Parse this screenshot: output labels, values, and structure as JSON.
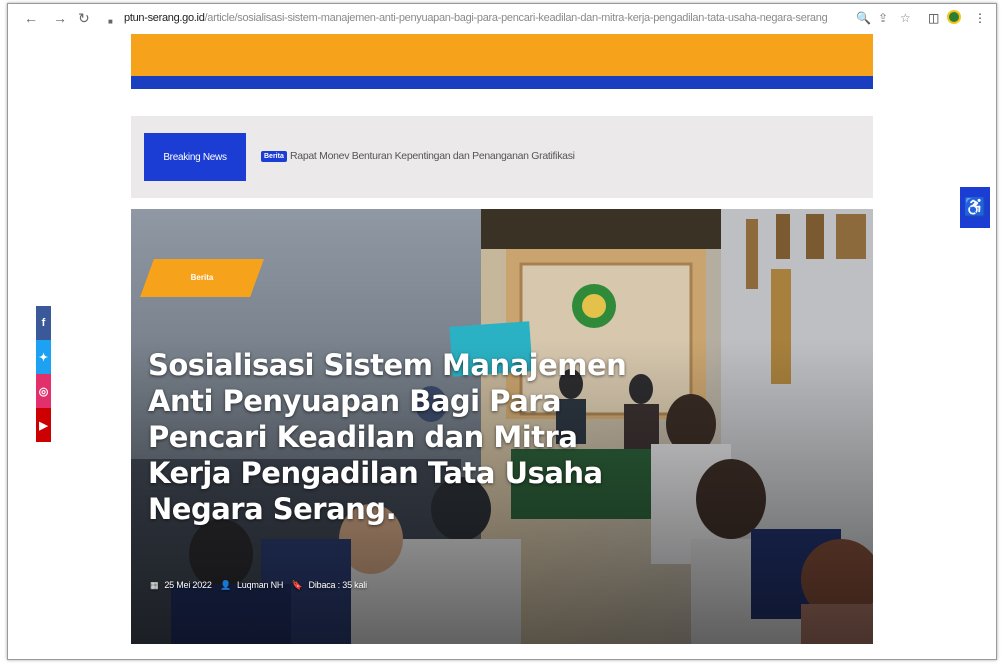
{
  "browser": {
    "back_glyph": "←",
    "forward_glyph": "→",
    "reload_glyph": "↻",
    "lock_glyph": "■",
    "url_host": "ptun-serang.go.id",
    "url_path": "/article/sosialisasi-sistem-manajemen-anti-penyuapan-bagi-para-pencari-keadilan-dan-mitra-kerja-pengadilan-tata-usaha-negara-serang",
    "icons": [
      "zoom-icon",
      "share-icon",
      "star-icon",
      "reading-list-icon",
      "extension-icon",
      "menu-icon"
    ],
    "zoom_glyph": "🔍",
    "share_glyph": "⇪",
    "star_glyph": "☆",
    "sidepanel_glyph": "◫",
    "menu_glyph": "⋮"
  },
  "ticker": {
    "label": "Breaking News",
    "badge": "Berita",
    "headline": "Rapat Monev Benturan Kepentingan dan Penanganan Gratifikasi"
  },
  "hero": {
    "category": "Berita",
    "title": "Sosialisasi Sistem Manajemen Anti Penyuapan Bagi Para Pencari Keadilan dan Mitra Kerja Pengadilan Tata Usaha Negara Serang.",
    "date": "25 Mei 2022",
    "author": "Luqman NH",
    "views": "Dibaca : 35 kali"
  },
  "social": [
    {
      "name": "facebook",
      "glyph": "f",
      "color": "#3b5998"
    },
    {
      "name": "twitter",
      "glyph": "✦",
      "color": "#1da1f2"
    },
    {
      "name": "instagram",
      "glyph": "◎",
      "color": "#e1306c"
    },
    {
      "name": "youtube",
      "glyph": "▶",
      "color": "#cc0000"
    }
  ],
  "accessibility": {
    "glyph": "♿",
    "color": "#1b3dd4"
  },
  "colors": {
    "orange": "#f7a21b",
    "blue": "#1a3ec0"
  }
}
